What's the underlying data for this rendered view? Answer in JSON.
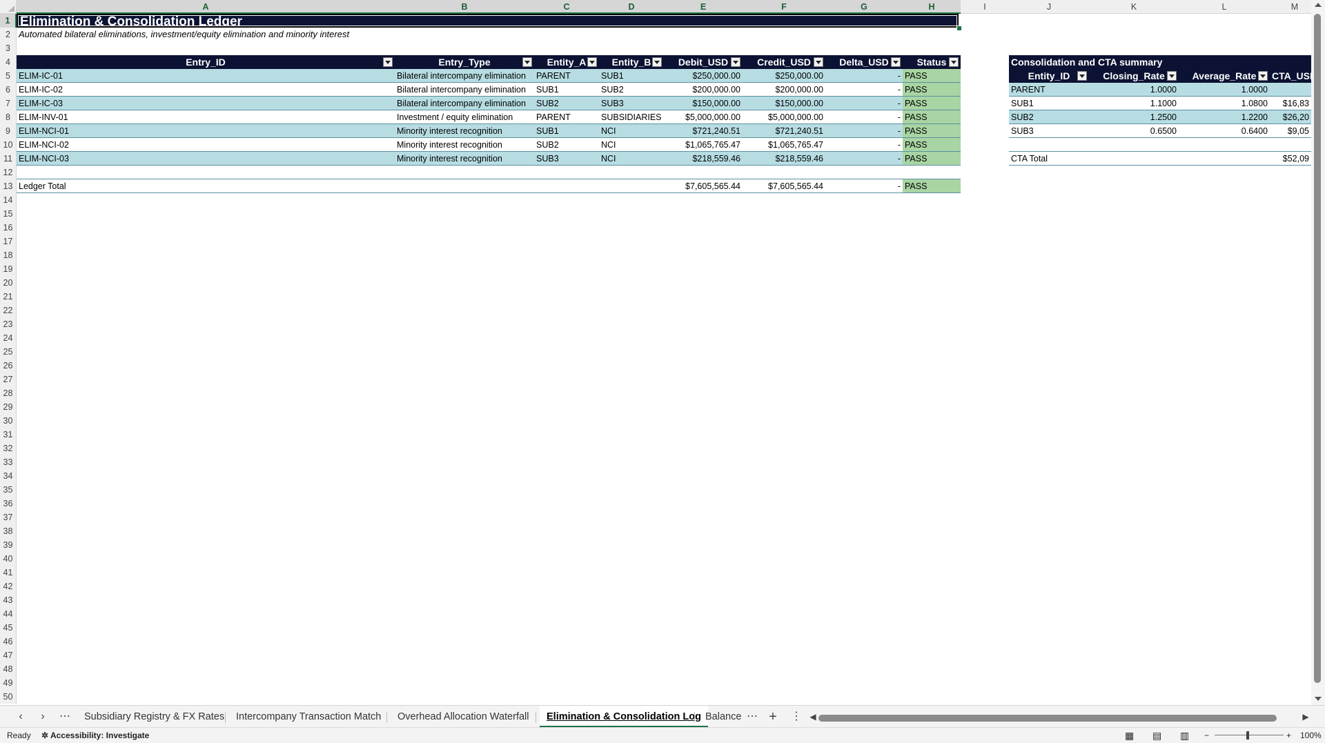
{
  "columns": [
    "A",
    "B",
    "C",
    "D",
    "E",
    "F",
    "G",
    "H",
    "I",
    "J",
    "K",
    "L",
    "M"
  ],
  "rows": [
    1,
    2,
    3,
    4,
    5,
    6,
    7,
    8,
    9,
    10,
    11,
    12,
    13,
    14,
    15,
    16,
    17,
    18,
    19,
    20,
    21,
    22,
    23,
    24,
    25,
    26,
    27,
    28,
    29,
    30,
    31,
    32,
    33,
    34,
    35,
    36,
    37,
    38,
    39,
    40,
    41,
    42,
    43,
    44,
    45,
    46,
    47,
    48,
    49,
    50
  ],
  "sheet": {
    "title": "Elimination & Consolidation Ledger",
    "subtitle": "Automated bilateral eliminations, investment/equity elimination and minority interest"
  },
  "ledger": {
    "headers": [
      "Entry_ID",
      "Entry_Type",
      "Entity_A",
      "Entity_B",
      "Debit_USD",
      "Credit_USD",
      "Delta_USD",
      "Status"
    ],
    "rows": [
      [
        "ELIM-IC-01",
        "Bilateral intercompany elimination",
        "PARENT",
        "SUB1",
        "$250,000.00",
        "$250,000.00",
        "-",
        "PASS"
      ],
      [
        "ELIM-IC-02",
        "Bilateral intercompany elimination",
        "SUB1",
        "SUB2",
        "$200,000.00",
        "$200,000.00",
        "-",
        "PASS"
      ],
      [
        "ELIM-IC-03",
        "Bilateral intercompany elimination",
        "SUB2",
        "SUB3",
        "$150,000.00",
        "$150,000.00",
        "-",
        "PASS"
      ],
      [
        "ELIM-INV-01",
        "Investment / equity elimination",
        "PARENT",
        "SUBSIDIARIES",
        "$5,000,000.00",
        "$5,000,000.00",
        "-",
        "PASS"
      ],
      [
        "ELIM-NCI-01",
        "Minority interest recognition",
        "SUB1",
        "NCI",
        "$721,240.51",
        "$721,240.51",
        "-",
        "PASS"
      ],
      [
        "ELIM-NCI-02",
        "Minority interest recognition",
        "SUB2",
        "NCI",
        "$1,065,765.47",
        "$1,065,765.47",
        "-",
        "PASS"
      ],
      [
        "ELIM-NCI-03",
        "Minority interest recognition",
        "SUB3",
        "NCI",
        "$218,559.46",
        "$218,559.46",
        "-",
        "PASS"
      ]
    ],
    "total": {
      "label": "Ledger Total",
      "debit": "$7,605,565.44",
      "credit": "$7,605,565.44",
      "delta": "-",
      "status": "PASS"
    }
  },
  "summary": {
    "title": "Consolidation and CTA summary",
    "headers": [
      "Entity_ID",
      "Closing_Rate",
      "Average_Rate",
      "CTA_USD"
    ],
    "rows": [
      [
        "PARENT",
        "1.0000",
        "1.0000",
        ""
      ],
      [
        "SUB1",
        "1.1000",
        "1.0800",
        "$16,83"
      ],
      [
        "SUB2",
        "1.2500",
        "1.2200",
        "$26,20"
      ],
      [
        "SUB3",
        "0.6500",
        "0.6400",
        "$9,05"
      ]
    ],
    "total": {
      "label": "CTA Total",
      "value": "$52,09"
    }
  },
  "tabs": [
    "Subsidiary Registry & FX Rates",
    "Intercompany Transaction Match",
    "Overhead Allocation Waterfall",
    "Elimination & Consolidation Log",
    "Balance"
  ],
  "active_tab": "Elimination & Consolidation Log",
  "status": {
    "ready": "Ready",
    "accessibility": "Accessibility: Investigate",
    "zoom": "100%"
  },
  "colors": {
    "header_bg": "#0c1233",
    "row_teal": "#b7dde3",
    "pass_green": "#a9d4a3",
    "accent": "#1e7145"
  }
}
